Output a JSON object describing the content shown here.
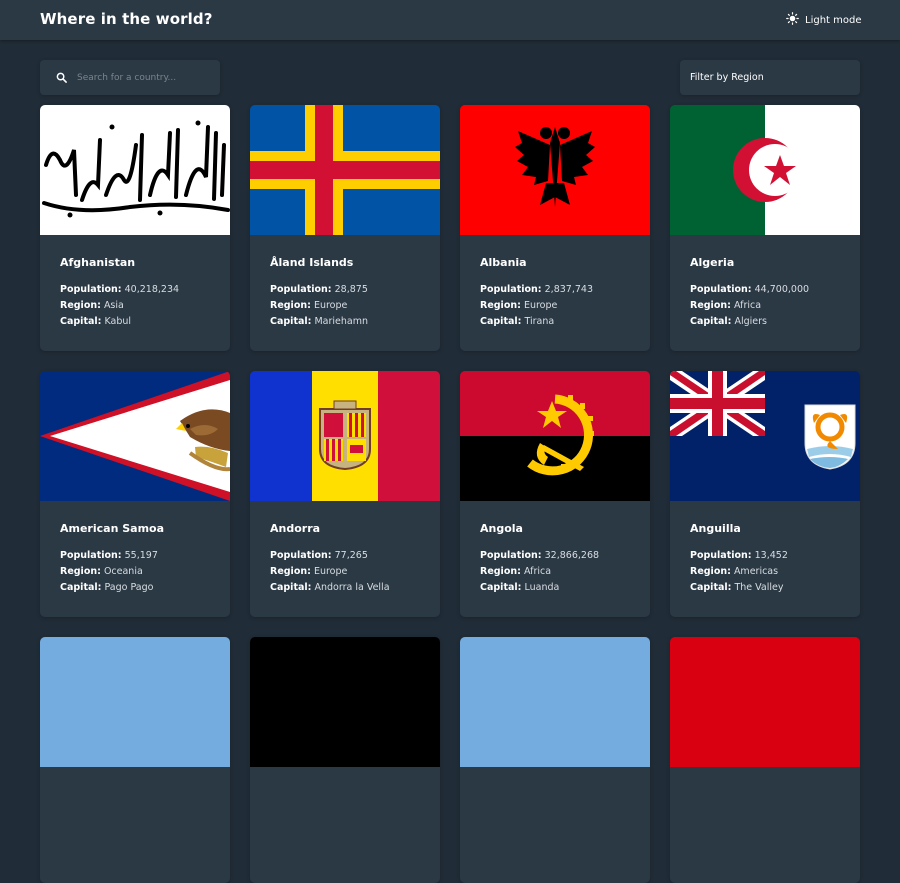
{
  "header": {
    "title": "Where in the world?",
    "mode_label": "Light mode"
  },
  "search": {
    "placeholder": "Search for a country..."
  },
  "filter": {
    "label": "Filter by Region"
  },
  "labels": {
    "population": "Population:",
    "region": "Region:",
    "capital": "Capital:"
  },
  "countries": [
    {
      "name": "Afghanistan",
      "population": "40,218,234",
      "region": "Asia",
      "capital": "Kabul"
    },
    {
      "name": "Åland Islands",
      "population": "28,875",
      "region": "Europe",
      "capital": "Mariehamn"
    },
    {
      "name": "Albania",
      "population": "2,837,743",
      "region": "Europe",
      "capital": "Tirana"
    },
    {
      "name": "Algeria",
      "population": "44,700,000",
      "region": "Africa",
      "capital": "Algiers"
    },
    {
      "name": "American Samoa",
      "population": "55,197",
      "region": "Oceania",
      "capital": "Pago Pago"
    },
    {
      "name": "Andorra",
      "population": "77,265",
      "region": "Europe",
      "capital": "Andorra la Vella"
    },
    {
      "name": "Angola",
      "population": "32,866,268",
      "region": "Africa",
      "capital": "Luanda"
    },
    {
      "name": "Anguilla",
      "population": "13,452",
      "region": "Americas",
      "capital": "The Valley"
    }
  ],
  "colors": {
    "background": "#202c37",
    "elements": "#2b3945",
    "text": "#ffffff"
  }
}
